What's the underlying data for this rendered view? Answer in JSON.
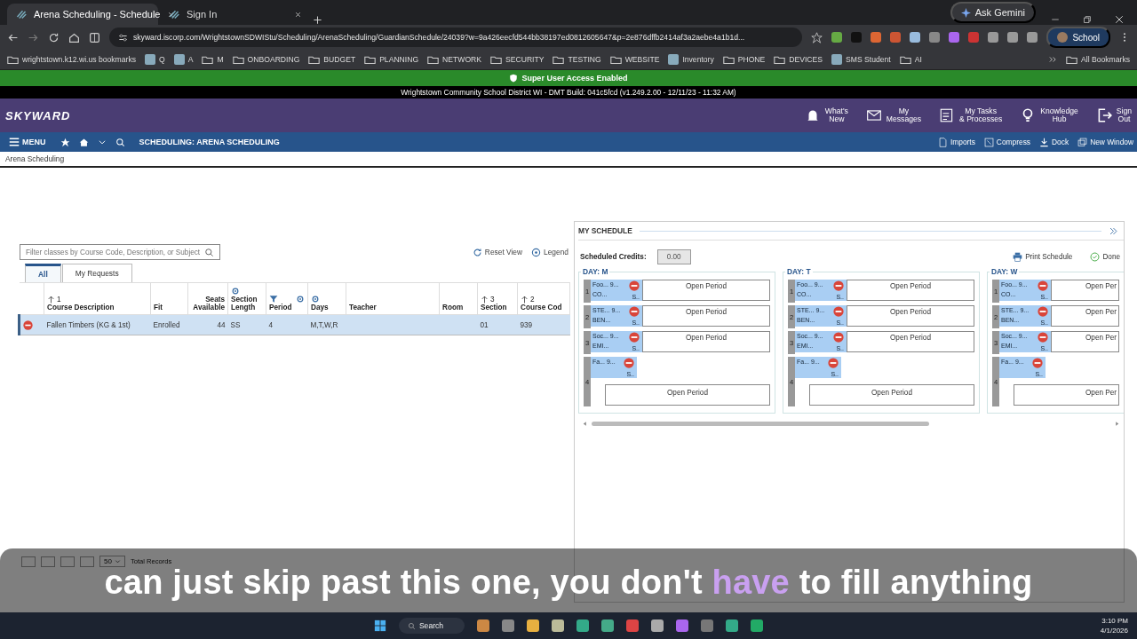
{
  "browser": {
    "tabs": [
      {
        "title": "Arena Scheduling - Schedule",
        "selected": true
      },
      {
        "title": "Sign In",
        "selected": false
      }
    ],
    "url": "skyward.iscorp.com/WrightstownSDWIStu/Scheduling/ArenaScheduling/GuardianSchedule/24039?w=9a426eecfd544bb38197ed0812605647&p=2e876dffb2414af3a2aebe4a1b1d...",
    "gemini": "Ask Gemini",
    "profile": "School",
    "bookmarks": [
      {
        "label": "wrightstown.k12.wi.us bookmarks",
        "kind": "folder"
      },
      {
        "label": "Q",
        "kind": "site"
      },
      {
        "label": "A",
        "kind": "site"
      },
      {
        "label": "M",
        "kind": "folder"
      },
      {
        "label": "ONBOARDING",
        "kind": "folder"
      },
      {
        "label": "BUDGET",
        "kind": "folder"
      },
      {
        "label": "PLANNING",
        "kind": "folder"
      },
      {
        "label": "NETWORK",
        "kind": "folder"
      },
      {
        "label": "SECURITY",
        "kind": "folder"
      },
      {
        "label": "TESTING",
        "kind": "folder"
      },
      {
        "label": "WEBSITE",
        "kind": "folder"
      },
      {
        "label": "Inventory",
        "kind": "site"
      },
      {
        "label": "PHONE",
        "kind": "folder"
      },
      {
        "label": "DEVICES",
        "kind": "folder"
      },
      {
        "label": "SMS Student",
        "kind": "site"
      },
      {
        "label": "AI",
        "kind": "folder"
      }
    ],
    "all_bookmarks": "All Bookmarks"
  },
  "banner": "Super User Access Enabled",
  "build": "Wrightstown Community School District WI - DMT Build: 041c5fcd (v1.249.2.00 - 12/11/23 - 11:32 AM)",
  "header": {
    "logo": "SKYWARD",
    "links": [
      {
        "lines": [
          "What's",
          "New"
        ],
        "kind": "bell"
      },
      {
        "lines": [
          "My",
          "Messages"
        ],
        "kind": "mail"
      },
      {
        "lines": [
          "My Tasks",
          "& Processes"
        ],
        "kind": "tasks"
      },
      {
        "lines": [
          "Knowledge",
          "Hub"
        ],
        "kind": "bulb"
      },
      {
        "lines": [
          "Sign",
          "Out"
        ],
        "kind": "exit"
      }
    ]
  },
  "menubar": {
    "menu": "MENU",
    "title": "SCHEDULING: ARENA SCHEDULING",
    "actions": [
      {
        "label": "Imports",
        "kind": "import"
      },
      {
        "label": "Compress",
        "kind": "compress"
      },
      {
        "label": "Dock",
        "kind": "dock"
      },
      {
        "label": "New Window",
        "kind": "window"
      }
    ]
  },
  "breadcrumb": "Arena Scheduling",
  "classes": {
    "filter_placeholder": "Filter classes by Course Code, Description, or Subject",
    "reset": "Reset View",
    "legend": "Legend",
    "tabs": [
      {
        "label": "All",
        "selected": true
      },
      {
        "label": "My Requests",
        "selected": false
      }
    ],
    "columns": [
      {
        "lines": [
          "Course Description"
        ],
        "sort": "1"
      },
      {
        "lines": [
          "Fit"
        ]
      },
      {
        "lines": [
          "Seats",
          "Available"
        ]
      },
      {
        "lines": [
          "Section",
          "Length"
        ]
      },
      {
        "lines": [
          "Period"
        ]
      },
      {
        "lines": [
          "Days"
        ]
      },
      {
        "lines": [
          "Teacher"
        ]
      },
      {
        "lines": [
          "Room"
        ]
      },
      {
        "lines": [
          "Section"
        ],
        "sort": "3"
      },
      {
        "lines": [
          "Course Cod"
        ],
        "sort": "2"
      }
    ],
    "rows": [
      {
        "selected": true,
        "cells": [
          "Fallen Timbers (KG & 1st)",
          "Enrolled",
          "44",
          "SS",
          "4",
          "M,T,W,R",
          "",
          "",
          "01",
          "939"
        ]
      }
    ],
    "page_size": "50",
    "total": "Total Records"
  },
  "schedule": {
    "title": "MY SCHEDULE",
    "credits_label": "Scheduled Credits:",
    "credits": "0.00",
    "print": "Print Schedule",
    "done": "Done",
    "days": [
      {
        "label": "DAY: M",
        "periods": [
          {
            "number": "1",
            "kind": "row",
            "title": "Foo... 9...",
            "sub": "CO...",
            "tag": "S..",
            "open": "Open Period"
          },
          {
            "number": "2",
            "kind": "row",
            "title": "STE... 9...",
            "sub": "BEN...",
            "tag": "S..",
            "open": "Open Period"
          },
          {
            "number": "3",
            "kind": "row",
            "title": "Soc... 9...",
            "sub": "EMI...",
            "tag": "S..",
            "open": "Open Period"
          },
          {
            "number": "4",
            "kind": "stacked",
            "title": "Fa... 9...",
            "tag": "S..",
            "open": "Open Period"
          }
        ]
      },
      {
        "label": "DAY: T",
        "periods": [
          {
            "number": "1",
            "kind": "row",
            "title": "Foo... 9...",
            "sub": "CO...",
            "tag": "S..",
            "open": "Open Period"
          },
          {
            "number": "2",
            "kind": "row",
            "title": "STE... 9...",
            "sub": "BEN...",
            "tag": "S..",
            "open": "Open Period"
          },
          {
            "number": "3",
            "kind": "row",
            "title": "Soc... 9...",
            "sub": "EMI...",
            "tag": "S..",
            "open": "Open Period"
          },
          {
            "number": "4",
            "kind": "stacked",
            "title": "Fa... 9...",
            "tag": "S..",
            "open": "Open Period"
          }
        ]
      },
      {
        "label": "DAY: W",
        "periods": [
          {
            "number": "1",
            "kind": "row",
            "title": "Foo... 9...",
            "sub": "CO...",
            "tag": "S..",
            "open": "Open Per"
          },
          {
            "number": "2",
            "kind": "row",
            "title": "STE... 9...",
            "sub": "BEN...",
            "tag": "S..",
            "open": "Open Per"
          },
          {
            "number": "3",
            "kind": "row",
            "title": "Soc... 9...",
            "sub": "EMI...",
            "tag": "S..",
            "open": "Open Per"
          },
          {
            "number": "4",
            "kind": "stacked",
            "title": "Fa... 9...",
            "tag": "S..",
            "open": "Open Per"
          }
        ]
      }
    ]
  },
  "caption": [
    {
      "text": "can just skip past this one, you don't ",
      "highlighted": false
    },
    {
      "text": "have",
      "highlighted": true
    },
    {
      "text": " to fill anything",
      "highlighted": false
    }
  ],
  "taskbar": {
    "search": "Search",
    "time": "3:10 PM",
    "date": "4/1/2026"
  }
}
